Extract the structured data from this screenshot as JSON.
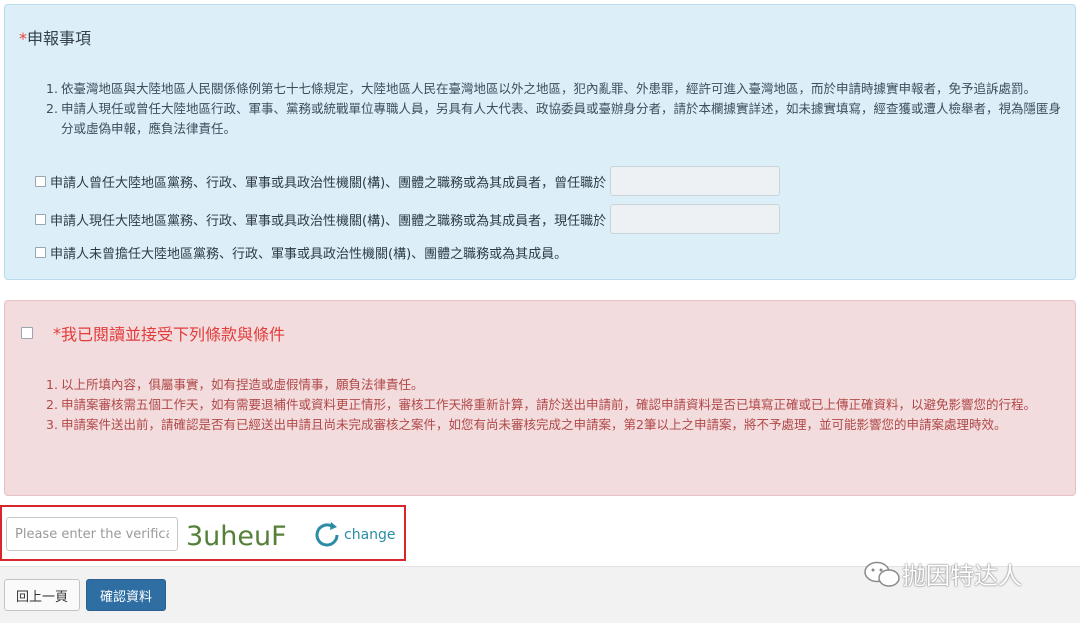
{
  "declaration": {
    "title": "申報事項",
    "required_mark": "*",
    "items": [
      {
        "num": "1.",
        "text": "依臺灣地區與大陸地區人民關係條例第七十七條規定，大陸地區人民在臺灣地區以外之地區，犯內亂罪、外患罪，經許可進入臺灣地區，而於申請時據實申報者，免予追訴處罰。"
      },
      {
        "num": "2.",
        "text": "申請人現任或曾任大陸地區行政、軍事、黨務或統戰單位專職人員，另具有人大代表、政協委員或臺辦身分者，請於本欄據實詳述，如未據實填寫，經查獲或遭人檢舉者，視為隱匿身分或虛偽申報，應負法律責任。"
      }
    ],
    "options": [
      {
        "label": "申請人曾任大陸地區黨務、行政、軍事或具政治性機關(構)、團體之職務或為其成員者，曾任職於",
        "has_input": true
      },
      {
        "label": "申請人現任大陸地區黨務、行政、軍事或具政治性機關(構)、團體之職務或為其成員者，現任職於",
        "has_input": true
      },
      {
        "label": "申請人未曾擔任大陸地區黨務、行政、軍事或具政治性機關(構)、團體之職務或為其成員。",
        "has_input": false
      }
    ]
  },
  "terms": {
    "required_mark": "*",
    "title": "我已閱讀並接受下列條款與條件",
    "items": [
      {
        "num": "1.",
        "text": "以上所填內容，俱屬事實，如有捏造或虛假情事，願負法律責任。"
      },
      {
        "num": "2.",
        "text": "申請案審核需五個工作天，如有需要退補件或資料更正情形，審核工作天將重新計算，請於送出申請前，確認申請資料是否已填寫正確或已上傳正確資料，以避免影響您的行程。"
      },
      {
        "num": "3.",
        "text": "申請案件送出前，請確認是否有已經送出申請且尚未完成審核之案件，如您有尚未審核完成之申請案，第2筆以上之申請案，將不予處理，並可能影響您的申請案處理時效。"
      }
    ]
  },
  "captcha": {
    "placeholder": "Please enter the verifica",
    "code_text": "3uheuF",
    "refresh_label": "change"
  },
  "buttons": {
    "back_label": "回上一頁",
    "confirm_label": "確認資料"
  },
  "watermark": {
    "text": "抛因特达人"
  },
  "colors": {
    "required": "#e8433c",
    "confirm_button": "#2f6ea3",
    "highlight_frame": "#d9262a",
    "refresh": "#2a8ca7"
  }
}
